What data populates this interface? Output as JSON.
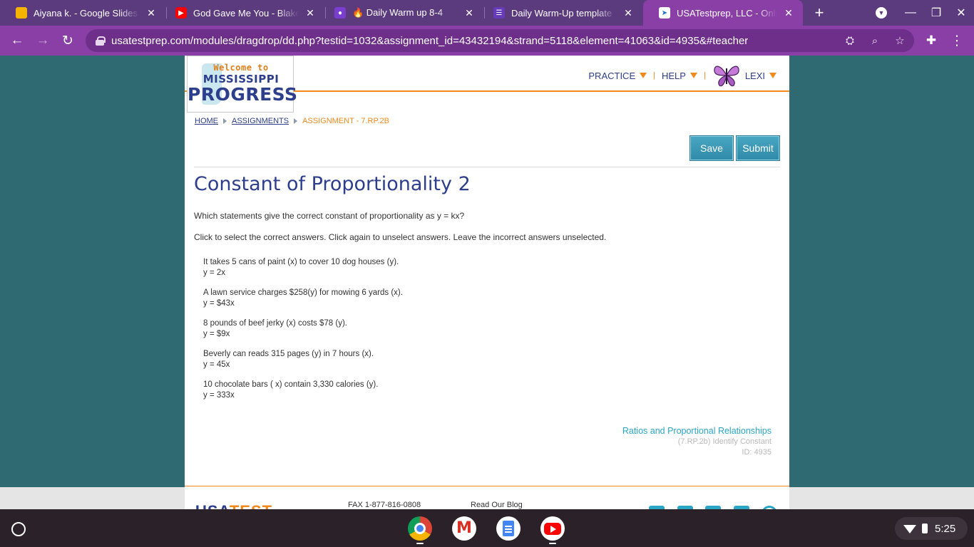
{
  "browser": {
    "tabs": [
      {
        "title": "Aiyana k. - Google Slides",
        "icon": "slides-icon",
        "color": "#f4b400",
        "active": false
      },
      {
        "title": "God Gave Me You - Blake S",
        "icon": "youtube-icon",
        "color": "#ff0000",
        "active": false
      },
      {
        "title": "🔥 Daily Warm up 8-4",
        "icon": "classroom-icon",
        "color": "#7b3fd0",
        "active": false
      },
      {
        "title": "Daily Warm-Up template",
        "icon": "forms-icon",
        "color": "#673ab7",
        "active": false
      },
      {
        "title": "USATestprep, LLC - Online",
        "icon": "usatestprep-icon",
        "color": "#1a73c8",
        "active": true
      }
    ],
    "url": "usatestprep.com/modules/dragdrop/dd.php?testid=1032&assignment_id=43432194&strand=5118&element=41063&id=4935&#teacher"
  },
  "logo": {
    "line1": "Welcome to",
    "line2": "MISSISSIPPI",
    "line3": "PROGRESS"
  },
  "nav": {
    "practice": "PRACTICE",
    "help": "HELP",
    "user": "LEXI"
  },
  "breadcrumb": {
    "home": "HOME",
    "assignments": "ASSIGNMENTS",
    "current": "ASSIGNMENT - 7.RP.2B"
  },
  "actions": {
    "save": "Save",
    "submit": "Submit"
  },
  "question": {
    "title": "Constant of Proportionality 2",
    "prompt": "Which statements give the correct constant of proportionality as y = kx?",
    "directions": "Click to select the correct answers. Click again to unselect answers. Leave the incorrect answers unselected.",
    "answers": [
      {
        "statement": "It takes 5 cans of paint (x) to cover 10 dog houses (y).",
        "equation": "y = 2x"
      },
      {
        "statement": "A lawn service charges $258(y) for mowing 6 yards (x).",
        "equation": "y = $43x"
      },
      {
        "statement": "8 pounds of beef jerky (x) costs $78 (y).",
        "equation": "y = $9x"
      },
      {
        "statement": "Beverly can reads 315 pages (y) in 7 hours (x).",
        "equation": "y = 45x"
      },
      {
        "statement": "10 chocolate bars ( x) contain 3,330 calories (y).",
        "equation": "y = 333x"
      }
    ]
  },
  "meta": {
    "standard": "Ratios and Proportional Relationships",
    "element": "(7.RP.2b) Identify Constant",
    "id": "ID: 4935"
  },
  "footer": {
    "logo_blue": "USA",
    "logo_orange": "TEST",
    "fax": "FAX 1-877-816-0808",
    "blog": "Read Our Blog"
  },
  "system": {
    "time": "5:25"
  }
}
